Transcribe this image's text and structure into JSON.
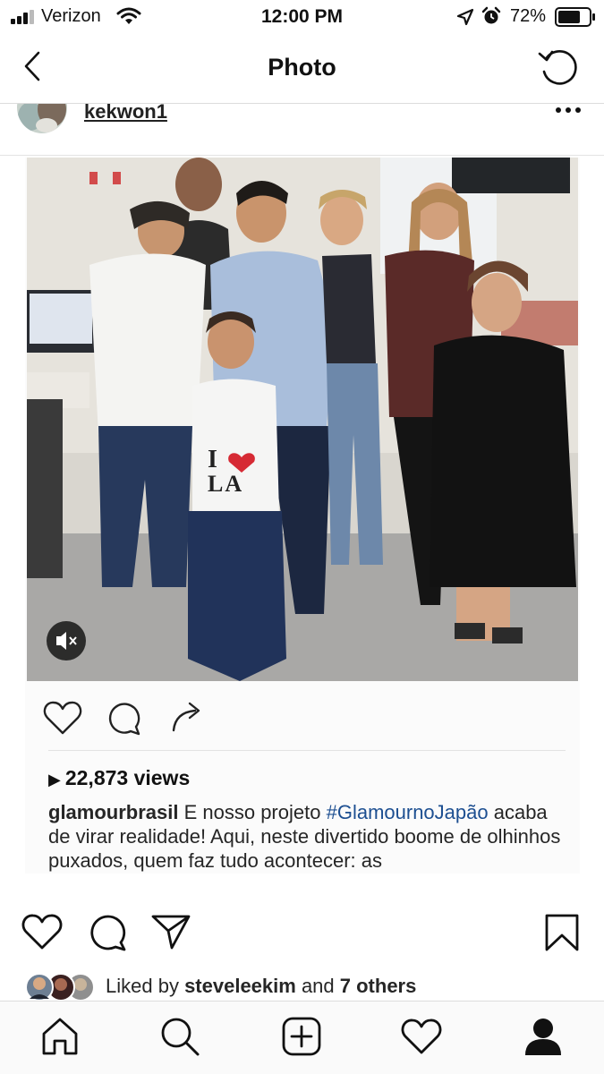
{
  "status_bar": {
    "carrier": "Verizon",
    "time": "12:00 PM",
    "battery_percent": "72%"
  },
  "nav": {
    "title": "Photo"
  },
  "post": {
    "username": "kekwon1"
  },
  "embedded_post": {
    "views": "22,873 views",
    "caption_user": "glamourbrasil",
    "caption_before_tag": " E nosso projeto ",
    "caption_tag": "#GlamournoJapão",
    "caption_after_tag": " acaba de virar realidade! Aqui, neste divertido boome de olhinhos puxados, quem faz tudo acontecer: as",
    "shirt_text_top": "I",
    "shirt_text_bottom": "LA"
  },
  "likes": {
    "prefix": "Liked by ",
    "user": "steveleekim",
    "middle": " and ",
    "others": "7 others"
  },
  "colors": {
    "text": "#111111",
    "link": "#1d4f91",
    "divider": "#dcdcdc"
  }
}
